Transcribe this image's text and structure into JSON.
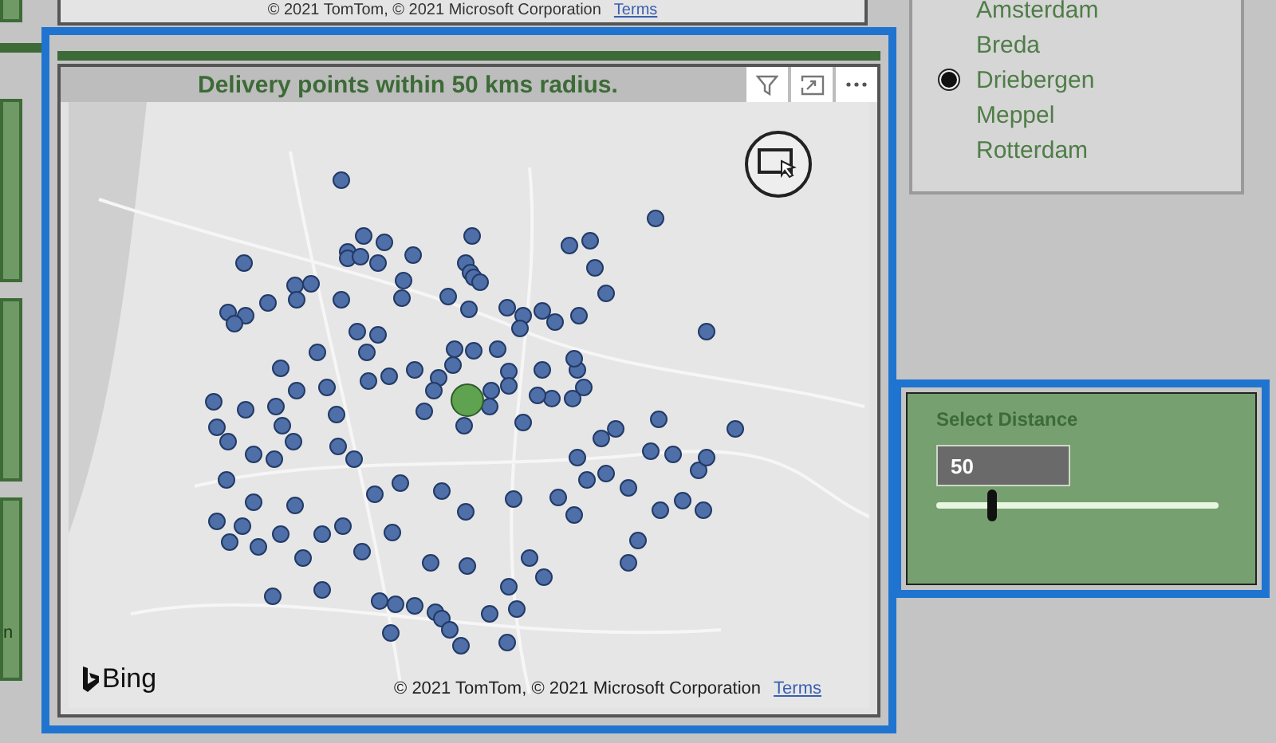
{
  "top_map": {
    "attribution": "© 2021 TomTom, © 2021 Microsoft Corporation",
    "terms": "Terms"
  },
  "left_card_text": "n",
  "map_visual": {
    "title": "Delivery points within 50 kms radius.",
    "logo": "Bing",
    "attribution": "© 2021 TomTom, © 2021 Microsoft Corporation",
    "terms": "Terms"
  },
  "city_slicer": {
    "items": [
      {
        "label": "Amsterdam",
        "selected": false
      },
      {
        "label": "Breda",
        "selected": false
      },
      {
        "label": "Driebergen",
        "selected": true
      },
      {
        "label": "Meppel",
        "selected": false
      },
      {
        "label": "Rotterdam",
        "selected": false
      }
    ]
  },
  "distance_slicer": {
    "title": "Select Distance",
    "value": "50",
    "level": 0.2
  }
}
